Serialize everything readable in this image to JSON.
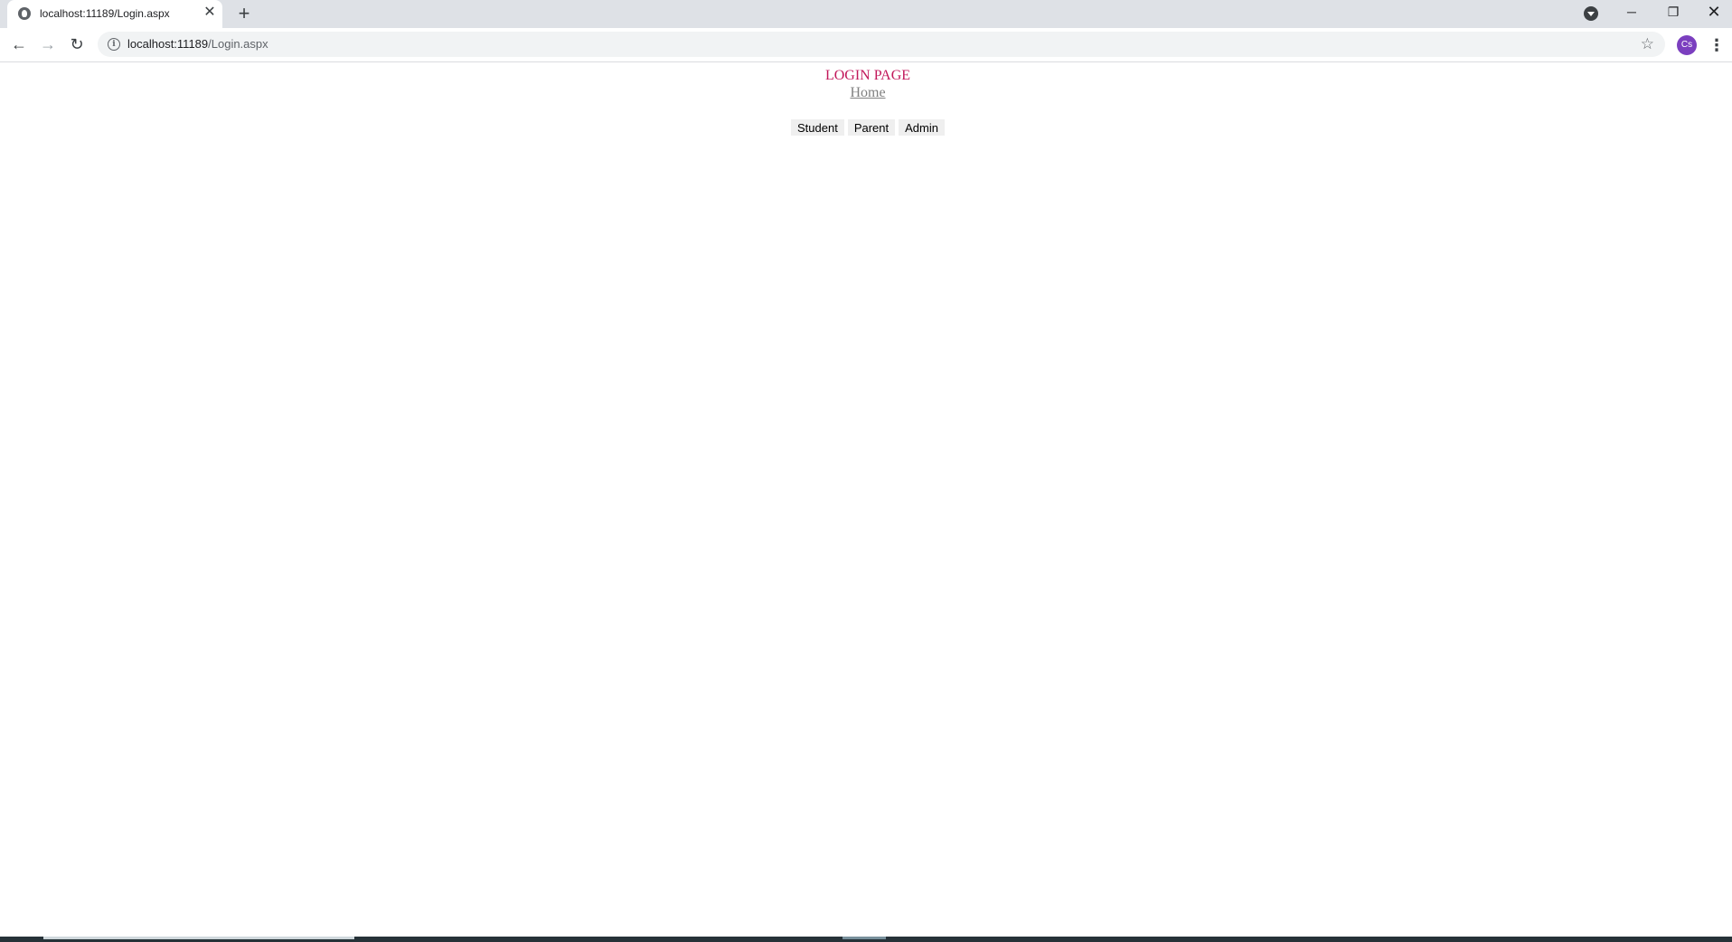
{
  "browser": {
    "tab": {
      "title": "localhost:11189/Login.aspx",
      "close_glyph": "✕"
    },
    "new_tab_glyph": "+",
    "window_controls": {
      "minimize": "─",
      "restore": "❐",
      "close": "✕"
    },
    "toolbar": {
      "back_glyph": "←",
      "forward_glyph": "→",
      "reload_glyph": "↻",
      "url_host": "localhost:11189",
      "url_path": "/Login.aspx",
      "bookmark_glyph": "☆",
      "profile_initials": "Cs",
      "menu_glyph": "⋮"
    }
  },
  "page": {
    "title": "LOGIN PAGE",
    "home_link": "Home",
    "role_buttons": [
      "Student",
      "Parent",
      "Admin"
    ]
  },
  "colors": {
    "title": "#c2185b",
    "link": "#808080",
    "tabstrip": "#dee1e6",
    "profile": "#7b3fbf"
  },
  "icons": {
    "favicon": "globe-icon",
    "info": "info-icon",
    "bookmark": "star-icon",
    "menu": "kebab-menu-icon",
    "tab_search": "tab-search-icon"
  }
}
